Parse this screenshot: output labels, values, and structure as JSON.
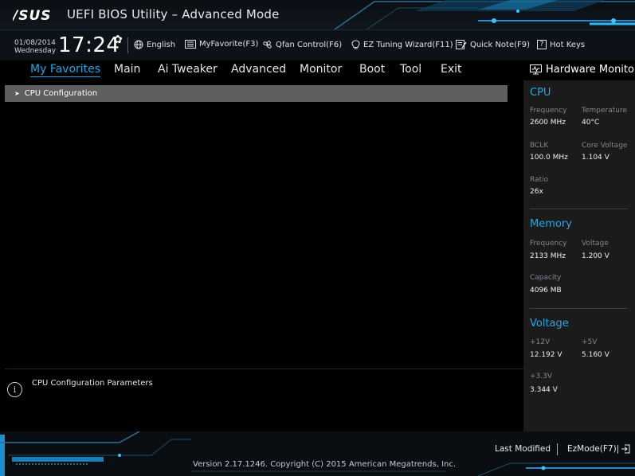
{
  "app": {
    "brand": "ASUS",
    "title": "UEFI BIOS Utility – Advanced Mode"
  },
  "status_bar": {
    "date": "01/08/2014",
    "weekday": "Wednesday",
    "time": "17:24",
    "settings_icon": "gear-icon",
    "items": [
      {
        "icon": "globe-icon",
        "label": "English"
      },
      {
        "icon": "favorite-window-icon",
        "label": "MyFavorite(F3)"
      },
      {
        "icon": "fan-icon",
        "label": "Qfan Control(F6)"
      },
      {
        "icon": "lightbulb-icon",
        "label": "EZ Tuning Wizard(F11)"
      },
      {
        "icon": "note-icon",
        "label": "Quick Note(F9)"
      },
      {
        "icon": "question-icon",
        "label": "Hot Keys"
      }
    ]
  },
  "menu": {
    "tabs": [
      "My Favorites",
      "Main",
      "Ai Tweaker",
      "Advanced",
      "Monitor",
      "Boot",
      "Tool",
      "Exit"
    ],
    "active": "My Favorites"
  },
  "content": {
    "items": [
      {
        "label": "CPU Configuration",
        "icon": "arrow-right-icon"
      }
    ]
  },
  "help": {
    "text": "CPU Configuration Parameters",
    "icon": "info-icon"
  },
  "hardware_monitor": {
    "title": "Hardware Monitor",
    "icon": "monitor-icon",
    "cpu": {
      "title": "CPU",
      "frequency_label": "Frequency",
      "frequency": "2600 MHz",
      "temperature_label": "Temperature",
      "temperature": "40°C",
      "bclk_label": "BCLK",
      "bclk": "100.0 MHz",
      "core_voltage_label": "Core Voltage",
      "core_voltage": "1.104 V",
      "ratio_label": "Ratio",
      "ratio": "26x"
    },
    "memory": {
      "title": "Memory",
      "frequency_label": "Frequency",
      "frequency": "2133 MHz",
      "voltage_label": "Voltage",
      "voltage": "1.200 V",
      "capacity_label": "Capacity",
      "capacity": "4096 MB"
    },
    "voltage": {
      "title": "Voltage",
      "v12_label": "+12V",
      "v12": "12.192 V",
      "v5_label": "+5V",
      "v5": "5.160 V",
      "v33_label": "+3.3V",
      "v33": "3.344 V"
    }
  },
  "bottom_bar": {
    "copyright": "Version 2.17.1246. Copyright (C) 2015 American Megatrends, Inc.",
    "last_modified": "Last Modified",
    "ezmode": "EzMode(F7)|",
    "ezmode_icon": "exit-arrow-icon"
  },
  "colors": {
    "accent": "#1ba8e6",
    "selected_row": "#5f5f5f",
    "panel_bg": "#1b1b1b",
    "background": "#000000"
  }
}
